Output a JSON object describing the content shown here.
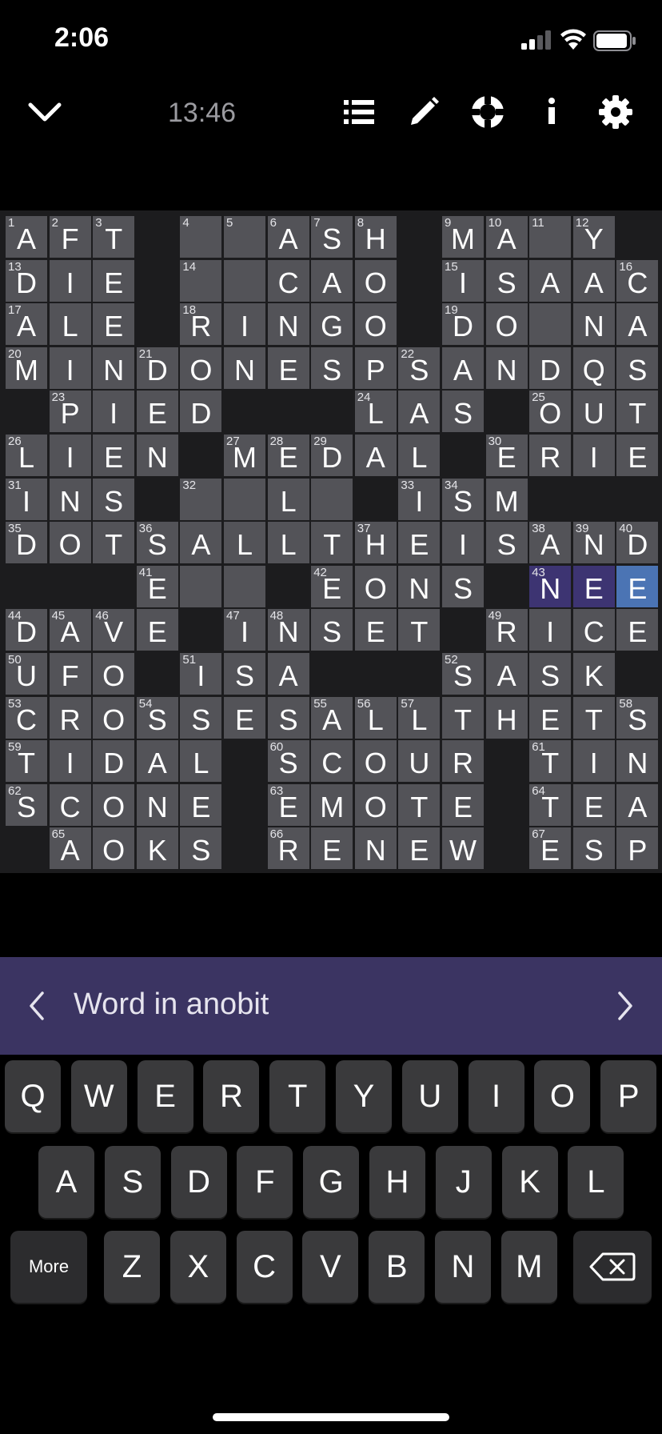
{
  "status": {
    "time": "2:06"
  },
  "toolbar": {
    "timer": "13:46",
    "icons": [
      "chevron-down-icon",
      "list-icon",
      "pencil-icon",
      "lifebuoy-icon",
      "info-icon",
      "gear-icon"
    ]
  },
  "puzzle": {
    "rows": [
      "AFT#..ASH#MA.Y#",
      "DIE#..CAO#ISAAC",
      "ALE#RINGO#DO.NA",
      "MINDONESPSANDQS",
      "#PIED###LAS#OUT",
      "LIEN#MEDAL#ERIE",
      "INS#..L.#ISM###",
      "DOTSALLTHEISAND",
      "###E..#EONS#NEE",
      "DAVE#INSET#RICE",
      "UFO#ISA###SASK#",
      "CROSSESALLTHETS",
      "TIDAL#SCOUR#TIN",
      "SCONE#EMOTE#TEA",
      "#AOKS#RENEW#ESP"
    ],
    "numbers": [
      [
        0,
        0,
        1
      ],
      [
        0,
        1,
        2
      ],
      [
        0,
        2,
        3
      ],
      [
        0,
        4,
        4
      ],
      [
        0,
        5,
        5
      ],
      [
        0,
        6,
        6
      ],
      [
        0,
        7,
        7
      ],
      [
        0,
        8,
        8
      ],
      [
        0,
        10,
        9
      ],
      [
        0,
        11,
        10
      ],
      [
        0,
        12,
        11
      ],
      [
        0,
        13,
        12
      ],
      [
        1,
        0,
        13
      ],
      [
        1,
        4,
        14
      ],
      [
        1,
        10,
        15
      ],
      [
        1,
        14,
        16
      ],
      [
        2,
        0,
        17
      ],
      [
        2,
        4,
        18
      ],
      [
        2,
        10,
        19
      ],
      [
        3,
        0,
        20
      ],
      [
        3,
        3,
        21
      ],
      [
        3,
        9,
        22
      ],
      [
        4,
        1,
        23
      ],
      [
        4,
        8,
        24
      ],
      [
        4,
        12,
        25
      ],
      [
        5,
        0,
        26
      ],
      [
        5,
        5,
        27
      ],
      [
        5,
        6,
        28
      ],
      [
        5,
        7,
        29
      ],
      [
        5,
        11,
        30
      ],
      [
        6,
        0,
        31
      ],
      [
        6,
        4,
        32
      ],
      [
        6,
        9,
        33
      ],
      [
        6,
        10,
        34
      ],
      [
        7,
        0,
        35
      ],
      [
        7,
        3,
        36
      ],
      [
        7,
        8,
        37
      ],
      [
        7,
        12,
        38
      ],
      [
        7,
        13,
        39
      ],
      [
        7,
        14,
        40
      ],
      [
        8,
        3,
        41
      ],
      [
        8,
        7,
        42
      ],
      [
        8,
        12,
        43
      ],
      [
        9,
        0,
        44
      ],
      [
        9,
        1,
        45
      ],
      [
        9,
        2,
        46
      ],
      [
        9,
        5,
        47
      ],
      [
        9,
        6,
        48
      ],
      [
        9,
        11,
        49
      ],
      [
        10,
        0,
        50
      ],
      [
        10,
        4,
        51
      ],
      [
        10,
        10,
        52
      ],
      [
        11,
        0,
        53
      ],
      [
        11,
        3,
        54
      ],
      [
        11,
        7,
        55
      ],
      [
        11,
        8,
        56
      ],
      [
        11,
        9,
        57
      ],
      [
        11,
        14,
        58
      ],
      [
        12,
        0,
        59
      ],
      [
        12,
        6,
        60
      ],
      [
        12,
        12,
        61
      ],
      [
        13,
        0,
        62
      ],
      [
        13,
        6,
        63
      ],
      [
        13,
        12,
        64
      ],
      [
        14,
        1,
        65
      ],
      [
        14,
        6,
        66
      ],
      [
        14,
        12,
        67
      ]
    ],
    "highlighted": [
      [
        8,
        12
      ],
      [
        8,
        13
      ]
    ],
    "selected": [
      8,
      14
    ]
  },
  "clue": {
    "text": "Word in anobit"
  },
  "keyboard": {
    "row1": [
      "Q",
      "W",
      "E",
      "R",
      "T",
      "Y",
      "U",
      "I",
      "O",
      "P"
    ],
    "row2": [
      "A",
      "S",
      "D",
      "F",
      "G",
      "H",
      "J",
      "K",
      "L"
    ],
    "row3": [
      "Z",
      "X",
      "C",
      "V",
      "B",
      "N",
      "M"
    ],
    "more_label": "More",
    "backspace_icon": "backspace-icon"
  },
  "colors": {
    "cell": "#535358",
    "block": "#1c1c1e",
    "word_highlight": "#3d3472",
    "selected_cell": "#4b74b4",
    "clue_bar": "#3b3462"
  }
}
